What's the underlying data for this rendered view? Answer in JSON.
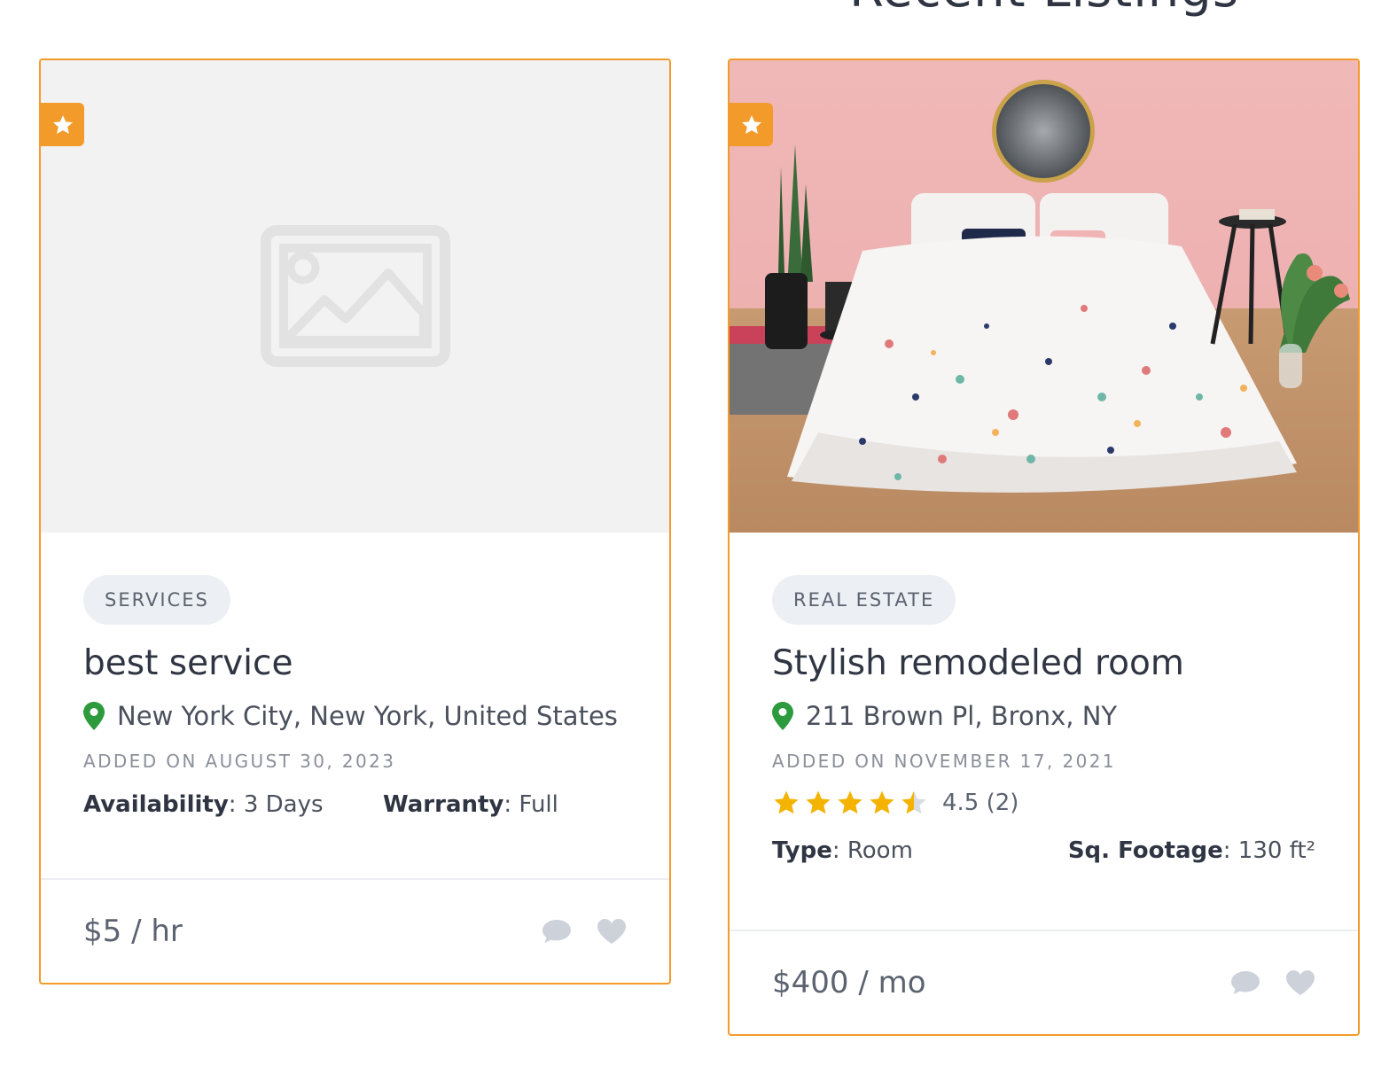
{
  "section": {
    "title": "Recent Listings"
  },
  "colors": {
    "accent": "#f29b2a",
    "pin": "#2e9a3e",
    "star": "#f5b301"
  },
  "listings": [
    {
      "category": "SERVICES",
      "title": "best service",
      "location": "New York City, New York, United States",
      "added": "ADDED ON AUGUST 30, 2023",
      "specs": [
        {
          "key": "Availability",
          "value": "3 Days"
        },
        {
          "key": "Warranty",
          "value": "Full"
        }
      ],
      "price": "$5 / hr",
      "image": "placeholder-image-icon",
      "featured_icon": "star-icon",
      "actions": [
        "comment-icon",
        "heart-icon"
      ]
    },
    {
      "category": "REAL ESTATE",
      "title": "Stylish remodeled room",
      "location": "211 Brown Pl, Bronx, NY",
      "added": "ADDED ON NOVEMBER 17, 2021",
      "rating": {
        "value": 4.5,
        "text": "4.5 (2)",
        "max": 5
      },
      "specs": [
        {
          "key": "Type",
          "value": "Room"
        },
        {
          "key": "Sq. Footage",
          "value": "130 ft²"
        }
      ],
      "price": "$400 / mo",
      "image": "bedroom-photo",
      "featured_icon": "star-icon",
      "actions": [
        "comment-icon",
        "heart-icon"
      ]
    }
  ]
}
